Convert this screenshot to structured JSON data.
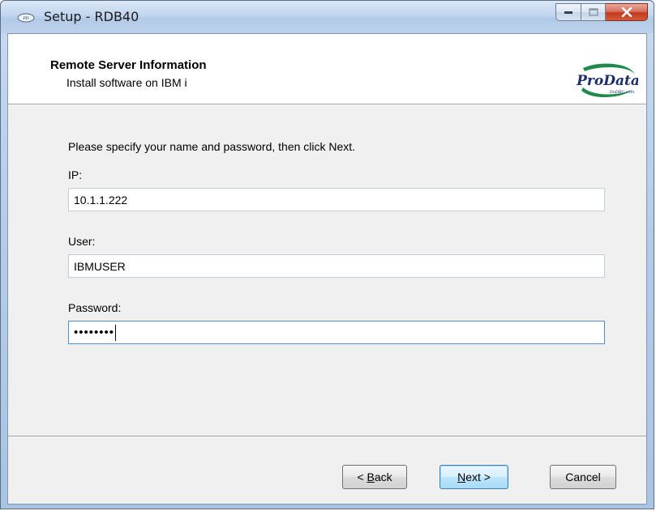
{
  "window": {
    "title": "Setup - RDB40",
    "icon": "prodata-app-icon"
  },
  "header": {
    "title": "Remote Server Information",
    "subtitle": "Install software on IBM i",
    "logo_text": "ProData",
    "logo_subtext": "DoDBC.com"
  },
  "form": {
    "instruction": "Please specify your name and password,  then click Next.",
    "ip_label": "IP:",
    "ip_value": "10.1.1.222",
    "user_label": "User:",
    "user_value": "IBMUSER",
    "password_label": "Password:",
    "password_value": "••••••••"
  },
  "buttons": {
    "back_prefix": "< ",
    "back_accel": "B",
    "back_rest": "ack",
    "next_accel": "N",
    "next_rest": "ext >",
    "cancel": "Cancel"
  },
  "colors": {
    "close_button": "#c2381c",
    "focus_border": "#4f8fd1",
    "default_button_border": "#3c7fb1"
  }
}
